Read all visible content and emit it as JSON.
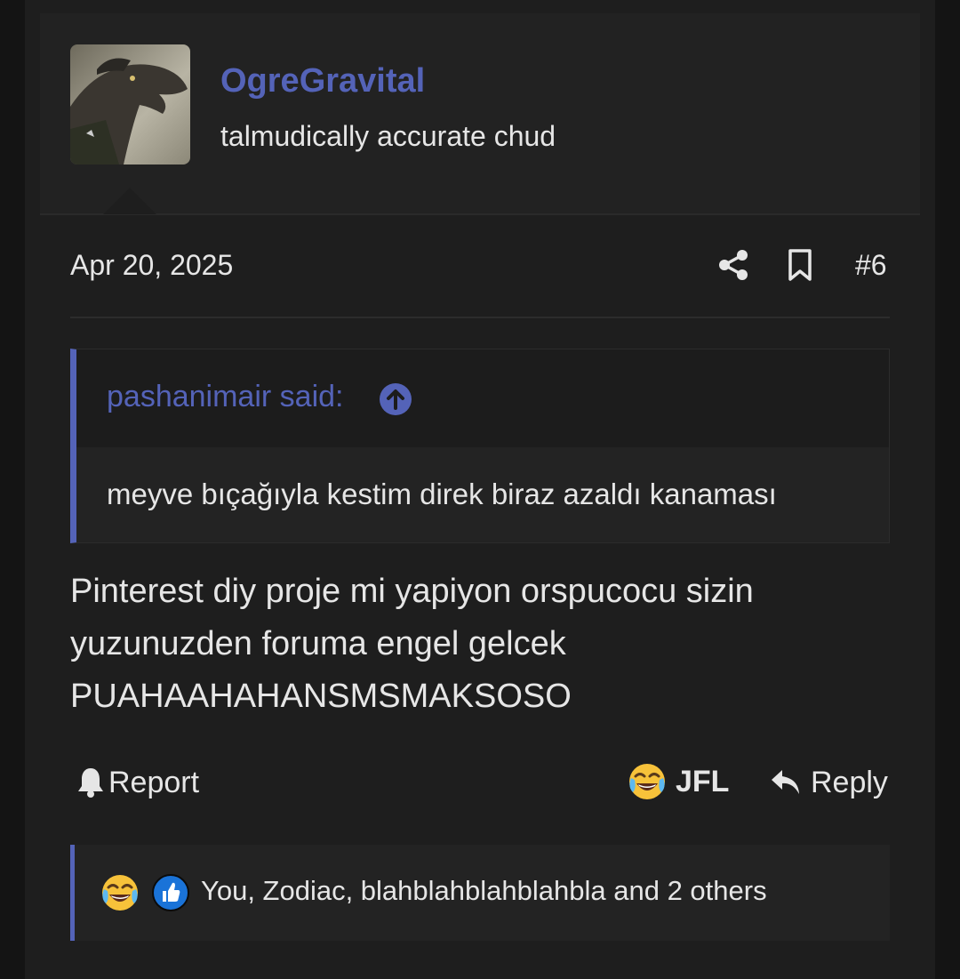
{
  "post": {
    "author": {
      "username": "OgreGravital",
      "title": "talmudically accurate chud",
      "avatar_icon": "avatar-image"
    },
    "date": "Apr 20, 2025",
    "post_number": "#6",
    "quote": {
      "author_label": "pashanimair said:",
      "text": "meyve bıçağıyla kestim direk biraz azaldı kanaması"
    },
    "body_lines": [
      "Pinterest diy proje mi yapiyon orspucocu sizin",
      "yuzunuzden foruma engel gelcek",
      "PUAHAAHAHANSMSMAKSOSO"
    ],
    "actions": {
      "report_label": "Report",
      "reaction_label": "JFL",
      "reply_label": "Reply"
    },
    "reactions_summary": "You, Zodiac, blahblahblahblahbla and 2 others"
  },
  "colors": {
    "accent": "#5463b8",
    "background": "#1e1e1e",
    "text": "#e6e6e6"
  }
}
